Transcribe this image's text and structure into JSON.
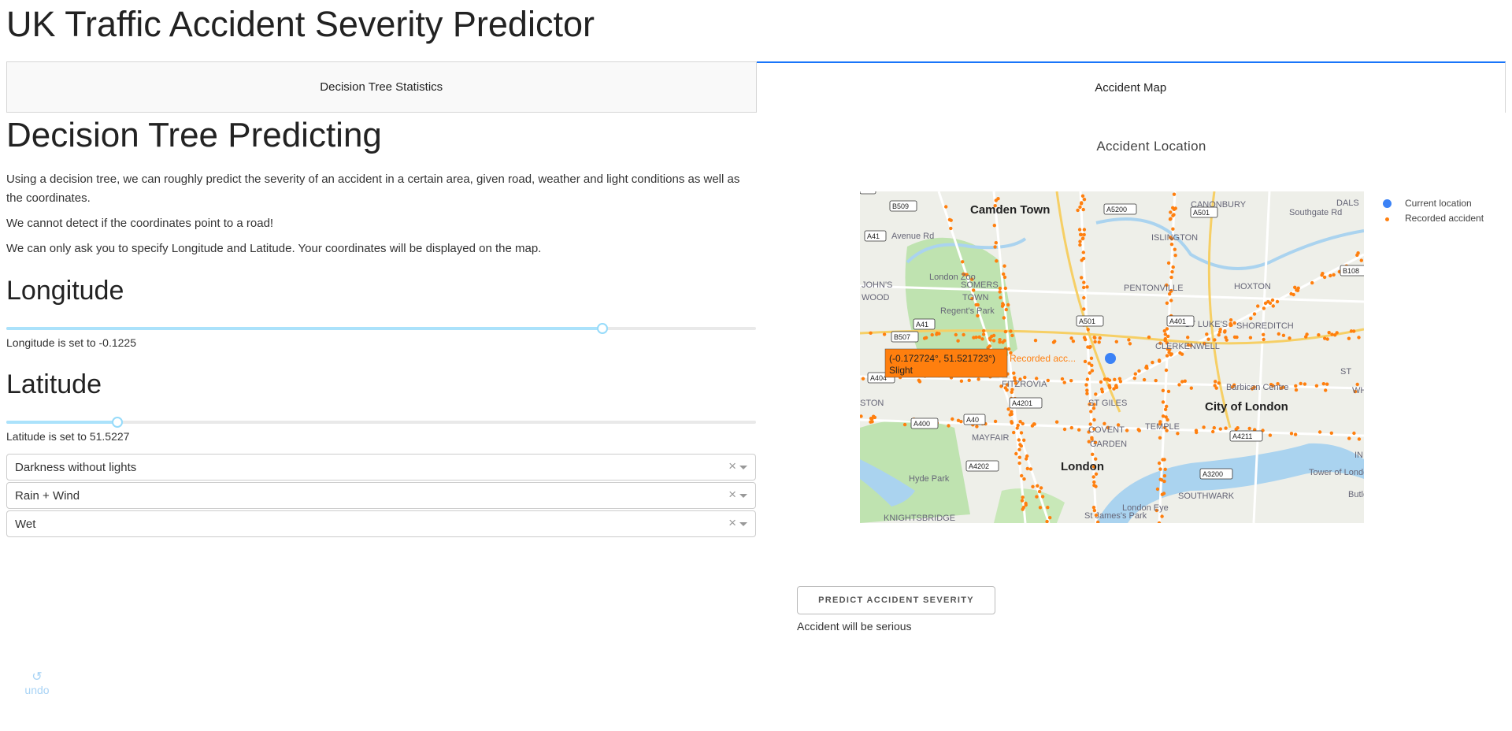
{
  "app": {
    "title": "UK Traffic Accident Severity Predictor"
  },
  "tabs": [
    {
      "label": "Decision Tree Statistics",
      "active": false
    },
    {
      "label": "Accident Map",
      "active": true
    }
  ],
  "left": {
    "heading": "Decision Tree Predicting",
    "paragraphs": [
      "Using a decision tree, we can roughly predict the severity of an accident in a certain area, given road, weather and light conditions as well as the coordinates.",
      "We cannot detect if the coordinates point to a road!",
      "We can only ask you to specify Longitude and Latitude. Your coordinates will be displayed on the map."
    ],
    "longitude": {
      "heading": "Longitude",
      "status": "Longitude is set to -0.1225",
      "value": -0.1225,
      "fraction": 0.795
    },
    "latitude": {
      "heading": "Latitude",
      "status": "Latitude is set to 51.5227",
      "value": 51.5227,
      "fraction": 0.148
    },
    "dropdowns": [
      {
        "value": "Darkness without lights",
        "clear": "×"
      },
      {
        "value": "Rain + Wind",
        "clear": "×"
      },
      {
        "value": "Wet",
        "clear": "×"
      }
    ]
  },
  "map": {
    "title": "Accident Location",
    "legend": [
      {
        "label": "Current location",
        "color": "#3b82f6"
      },
      {
        "label": "Recorded accident",
        "color": "#ff7f0e"
      }
    ],
    "places": [
      {
        "text": "Camden Town",
        "big": true
      },
      {
        "text": "CANONBURY"
      },
      {
        "text": "ISLINGTON"
      },
      {
        "text": "DALS"
      },
      {
        "text": "London Zoo"
      },
      {
        "text": "SOMERS"
      },
      {
        "text": "TOWN"
      },
      {
        "text": "PENTONVILLE"
      },
      {
        "text": "HOXTON"
      },
      {
        "text": "Regent's Park"
      },
      {
        "text": "ST LUKE'S"
      },
      {
        "text": "SHOREDITCH"
      },
      {
        "text": "CLERKENWELL"
      },
      {
        "text": "FITZROVIA"
      },
      {
        "text": "Barbican Centre"
      },
      {
        "text": "ST GILES"
      },
      {
        "text": "City of London",
        "big": true
      },
      {
        "text": "MAYFAIR"
      },
      {
        "text": "COVENT"
      },
      {
        "text": "GARDEN"
      },
      {
        "text": "TEMPLE"
      },
      {
        "text": "London",
        "big": true
      },
      {
        "text": "Hyde Park"
      },
      {
        "text": "Tower of London"
      },
      {
        "text": "SOUTHWARK"
      },
      {
        "text": "Butler's Wharf"
      },
      {
        "text": "London Eye"
      },
      {
        "text": "St James's Park"
      },
      {
        "text": "KNIGHTSBRIDGE"
      },
      {
        "text": "JOHN'S"
      },
      {
        "text": "WOOD"
      },
      {
        "text": "STON"
      },
      {
        "text": "Avenue Rd"
      },
      {
        "text": "Southgate Rd"
      },
      {
        "text": "ST"
      },
      {
        "text": "IN"
      },
      {
        "text": "WH"
      }
    ],
    "roads": [
      "B509",
      "A5200",
      "A41",
      "A501",
      "A401",
      "B108",
      "A41",
      "A501",
      "B507",
      "A404",
      "A4201",
      "A40",
      "A4211",
      "A400",
      "A4202",
      "A3200",
      "A1"
    ],
    "tooltip": {
      "coords": "(-0.172724°, 51.521723°)",
      "severity": "Slight",
      "series": "Recorded acc..."
    }
  },
  "actions": {
    "predict_label": "PREDICT ACCIDENT SEVERITY",
    "result": "Accident will be serious"
  },
  "undo": {
    "icon": "↺",
    "label": "undo"
  }
}
